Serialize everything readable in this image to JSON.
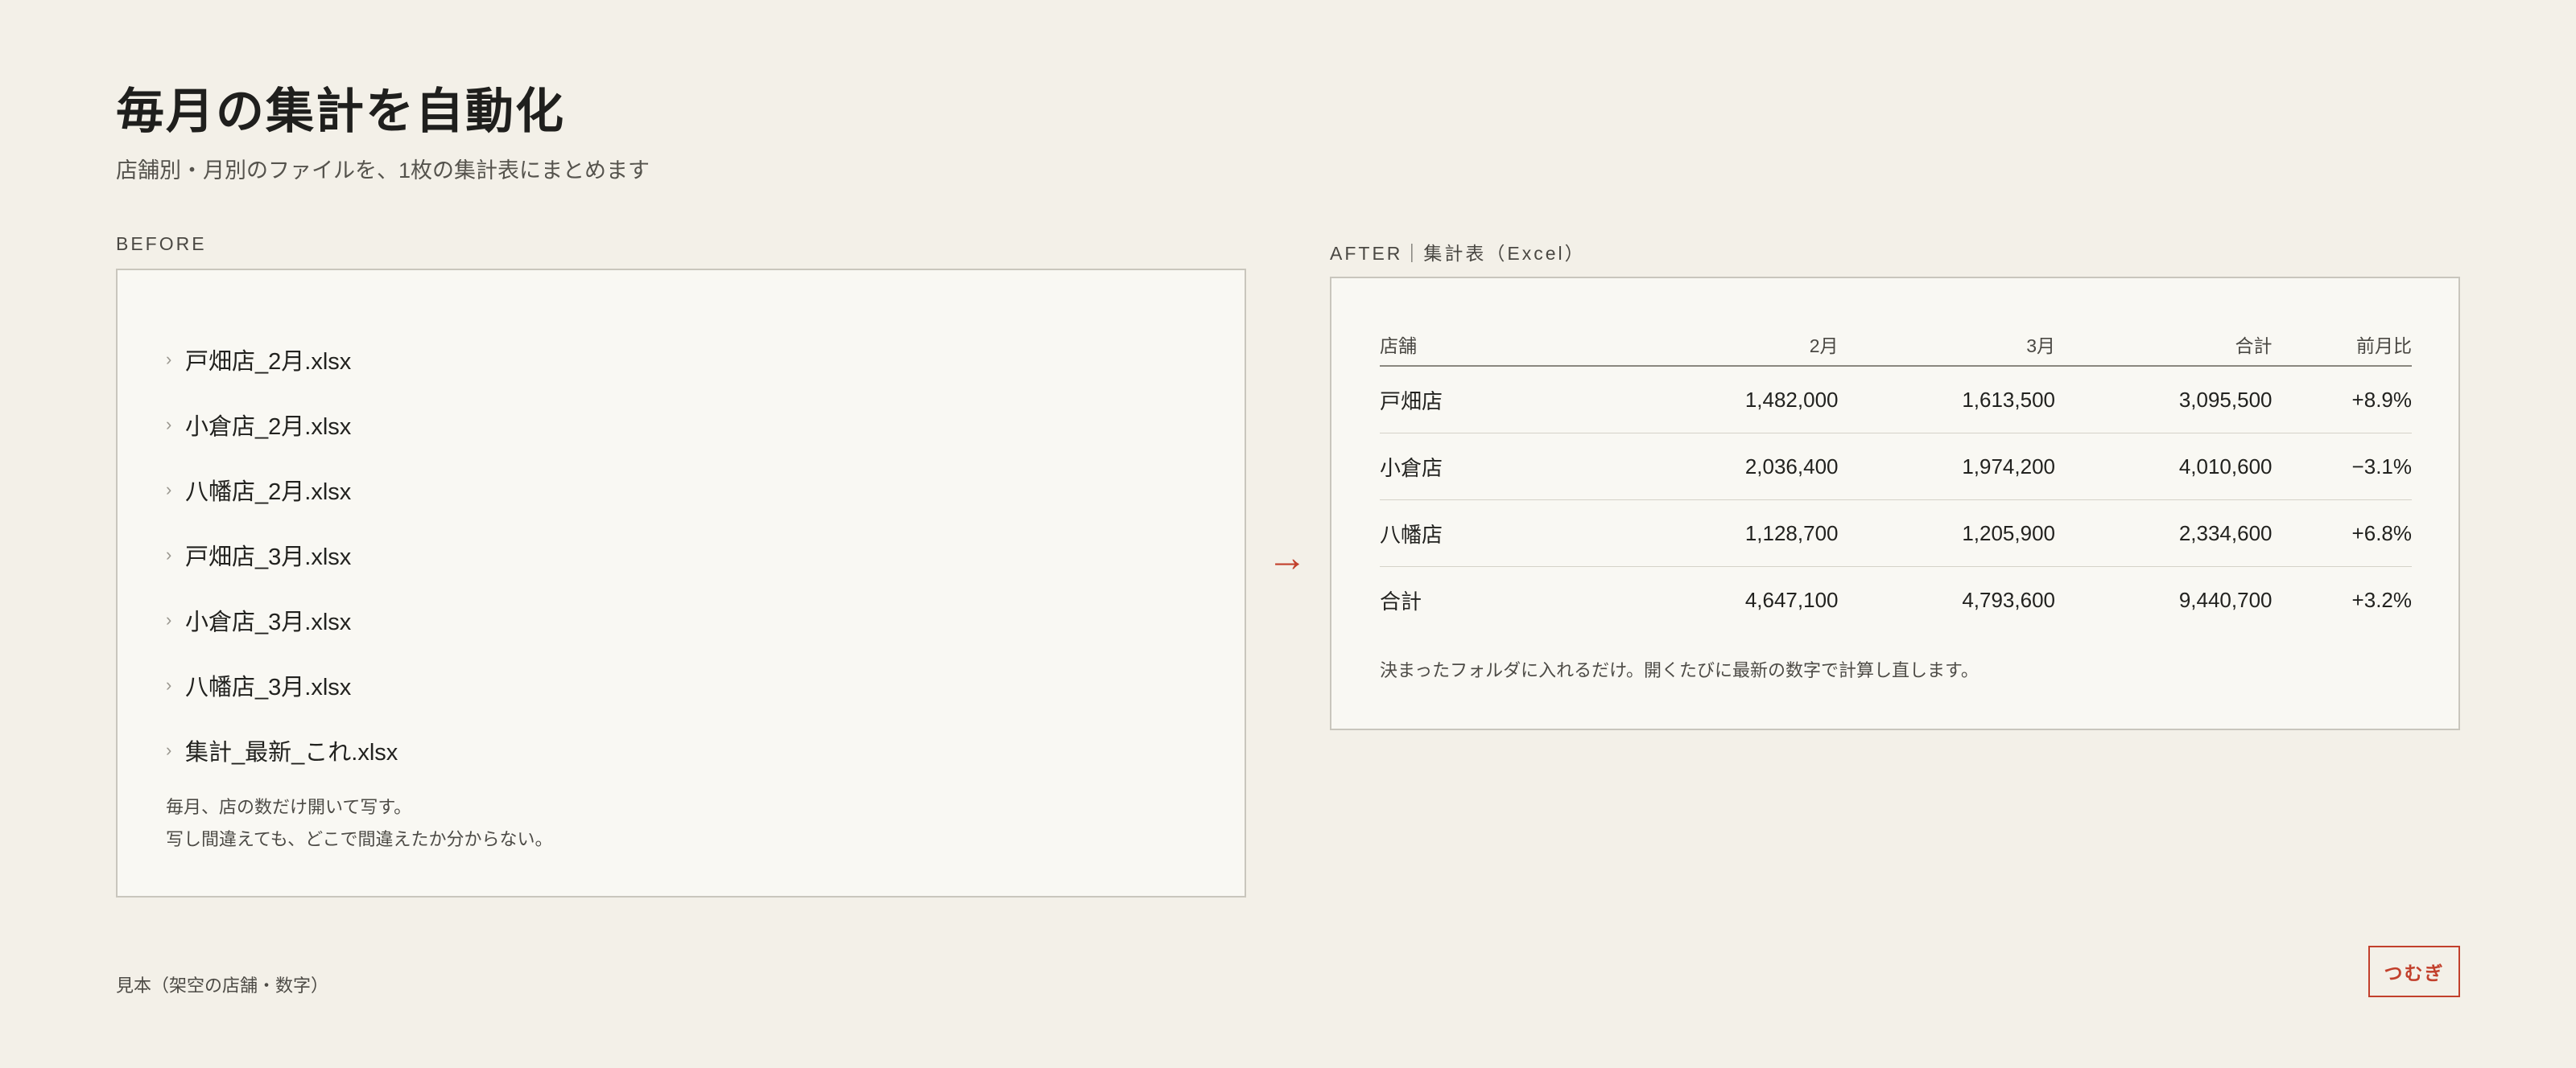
{
  "header": {
    "title": "毎月の集計を自動化",
    "subtitle": "店舗別・月別のファイルを、1枚の集計表にまとめます"
  },
  "before": {
    "label": "BEFORE",
    "files": [
      "戸畑店_2月.xlsx",
      "小倉店_2月.xlsx",
      "八幡店_2月.xlsx",
      "戸畑店_3月.xlsx",
      "小倉店_3月.xlsx",
      "八幡店_3月.xlsx",
      "集計_最新_これ.xlsx"
    ],
    "note_lines": [
      "毎月、店の数だけ開いて写す。",
      "写し間違えても、どこで間違えたか分からない。"
    ]
  },
  "arrow": "→",
  "after": {
    "label": "AFTER｜集計表（Excel）",
    "columns": [
      "店舗",
      "2月",
      "3月",
      "合計",
      "前月比"
    ],
    "rows": [
      [
        "戸畑店",
        "1,482,000",
        "1,613,500",
        "3,095,500",
        "+8.9%"
      ],
      [
        "小倉店",
        "2,036,400",
        "1,974,200",
        "4,010,600",
        "−3.1%"
      ],
      [
        "八幡店",
        "1,128,700",
        "1,205,900",
        "2,334,600",
        "+6.8%"
      ],
      [
        "合計",
        "4,647,100",
        "4,793,600",
        "9,440,700",
        "+3.2%"
      ]
    ],
    "note": "決まったフォルダに入れるだけ。開くたびに最新の数字で計算し直します。"
  },
  "footer": {
    "note": "見本（架空の店舗・数字）",
    "brand": "つむぎ"
  },
  "colors": {
    "background": "#f3f0e8",
    "panel": "#f9f8f3",
    "accent": "#c2402c"
  }
}
